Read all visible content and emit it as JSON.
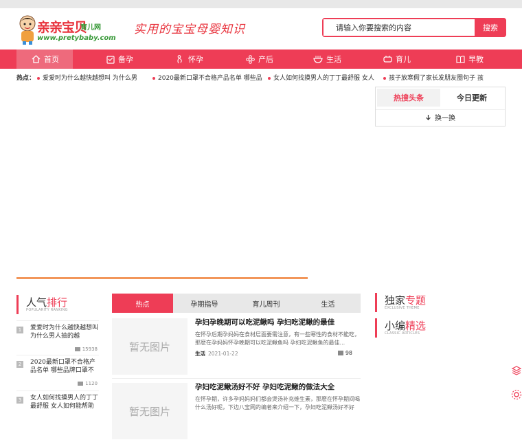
{
  "logo": {
    "title": "亲亲宝贝",
    "sub": "育儿网",
    "url": "www.pretybaby.com"
  },
  "slogan": "实用的宝宝母婴知识",
  "search": {
    "placeholder": "请输入你要搜索的内容",
    "button": "搜索"
  },
  "nav": [
    {
      "label": "首页",
      "icon": "home-icon"
    },
    {
      "label": "备孕",
      "icon": "clipboard-icon"
    },
    {
      "label": "怀孕",
      "icon": "pregnancy-icon"
    },
    {
      "label": "产后",
      "icon": "flower-icon"
    },
    {
      "label": "生活",
      "icon": "bowl-icon"
    },
    {
      "label": "育儿",
      "icon": "baby-icon"
    },
    {
      "label": "早教",
      "icon": "book-icon"
    }
  ],
  "hotline": {
    "label": "热点：",
    "items": [
      "爱爱时为什么越快越想叫 为什么男",
      "2020最新口罩不合格产品名单 哪些品",
      "女人如何找摸男人的丁丁最舒服 女人",
      "孩子放寒假了家长发朋友圈句子 孩"
    ]
  },
  "hot_tabs": {
    "tabs": [
      "热搜头条",
      "今日更新"
    ],
    "refresh": "换一换"
  },
  "ranking": {
    "title_black": "人气",
    "title_red": "排行",
    "sub": "POPULARITY RANKING",
    "items": [
      {
        "num": "1",
        "text": "爱爱时为什么越快越想叫 为什么男人抽的越",
        "views": "15938"
      },
      {
        "num": "2",
        "text": "2020最新口罩不合格产品名单 哪些品牌口罩不",
        "views": "1120"
      },
      {
        "num": "3",
        "text": "女人如何找摸男人的丁丁最舒服 女人如何能帮助",
        "views": ""
      }
    ]
  },
  "content_tabs": [
    "热点",
    "孕期指导",
    "育儿周刊",
    "生活"
  ],
  "articles": [
    {
      "thumb": "暂无图片",
      "title": "孕妇孕晚期可以吃泥鳅吗 孕妇吃泥鳅的最佳",
      "desc": "在怀孕后期孕妈妈在食材层面要需注意，有一些寒性的食材不能吃，那麽在孕妈妈怀孕晚期可以吃泥鳅鱼吗 孕妇吃泥鳅鱼的最佳...",
      "category": "生活",
      "date": "2021-01-22",
      "count": "98"
    },
    {
      "thumb": "暂无图片",
      "title": "孕妇吃泥鳅汤好不好 孕妇吃泥鳅的做法大全",
      "desc": "在怀孕期，许多孕妈妈妈们都会煲汤补充维生素，那麽在怀孕期间喝什么汤好呢，下边八宝网的编者来介绍一下，孕妇吃泥鳅汤好不好",
      "category": "",
      "date": "",
      "count": ""
    }
  ],
  "exclusive": {
    "title_black": "独家",
    "title_red": "专题",
    "sub": "EXCLUSIVE THEME"
  },
  "editor": {
    "title_black": "小编",
    "title_red": "精选",
    "sub": "CLASSIC ARTICLES"
  }
}
